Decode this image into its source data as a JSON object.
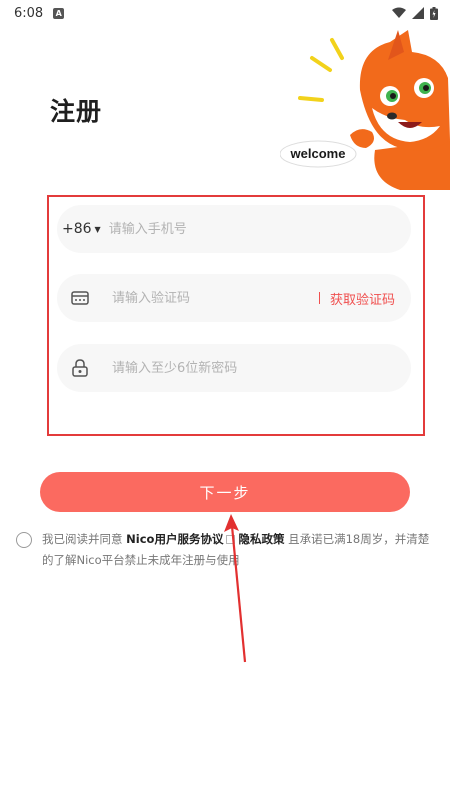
{
  "status_bar": {
    "time": "6:08",
    "notification_badge": "A"
  },
  "title": "注册",
  "mascot": {
    "sign_text": "welcome",
    "icon": "fox-mascot"
  },
  "form": {
    "phone": {
      "country_code": "+86",
      "placeholder": "请输入手机号",
      "value": ""
    },
    "code": {
      "placeholder": "请输入验证码",
      "value": "",
      "get_code_label": "获取验证码"
    },
    "password": {
      "placeholder": "请输入至少6位新密码",
      "value": ""
    }
  },
  "next_button": "下一步",
  "agreement": {
    "prefix": "我已阅读并同意 ",
    "service_link": "Nico用户服务协议",
    "privacy_link": "隐私政策",
    "suffix": " 且承诺已满18周岁，并清楚的了解Nico平台禁止未成年注册与使用"
  },
  "colors": {
    "accent": "#fb6a60",
    "highlight_border": "#e33b3b",
    "link_red": "#f0504f"
  }
}
